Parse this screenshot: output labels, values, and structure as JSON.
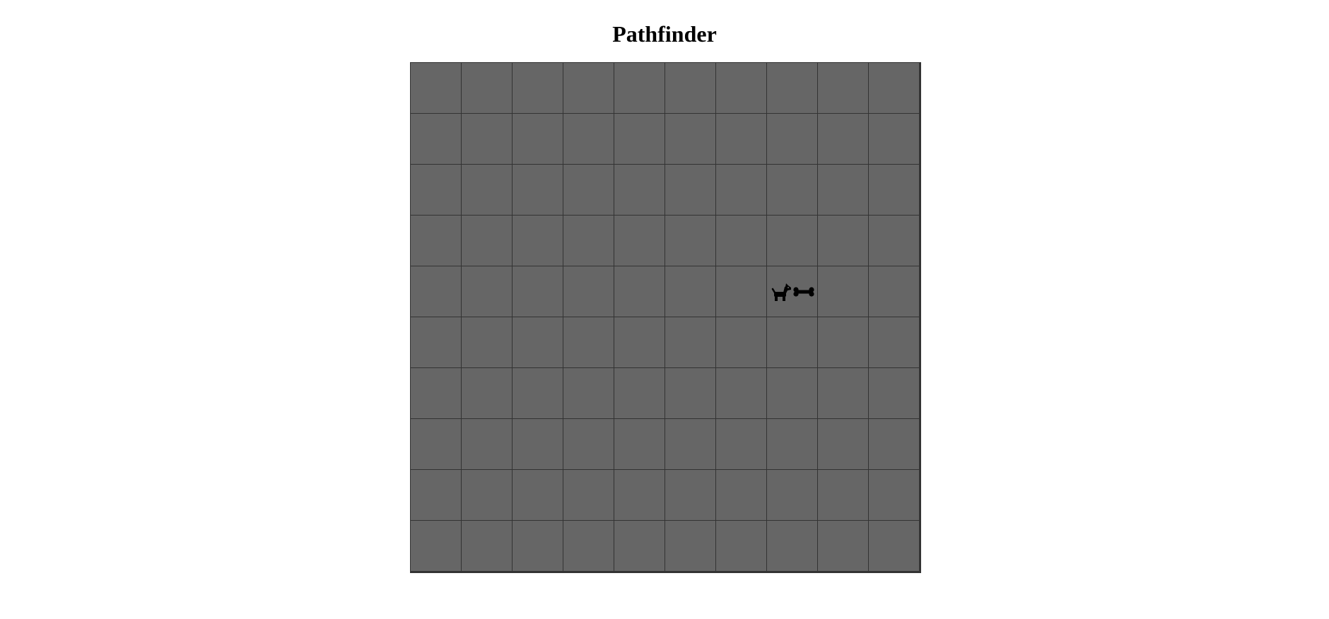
{
  "title": "Pathfinder",
  "board": {
    "rows": 10,
    "cols": 10,
    "cell_color": "#666666",
    "line_color": "#333333",
    "pieces": [
      {
        "name": "dog",
        "icon": "dog-icon",
        "row": 5,
        "col": 8
      },
      {
        "name": "bone",
        "icon": "bone-icon",
        "row": 5,
        "col": 8
      }
    ]
  }
}
